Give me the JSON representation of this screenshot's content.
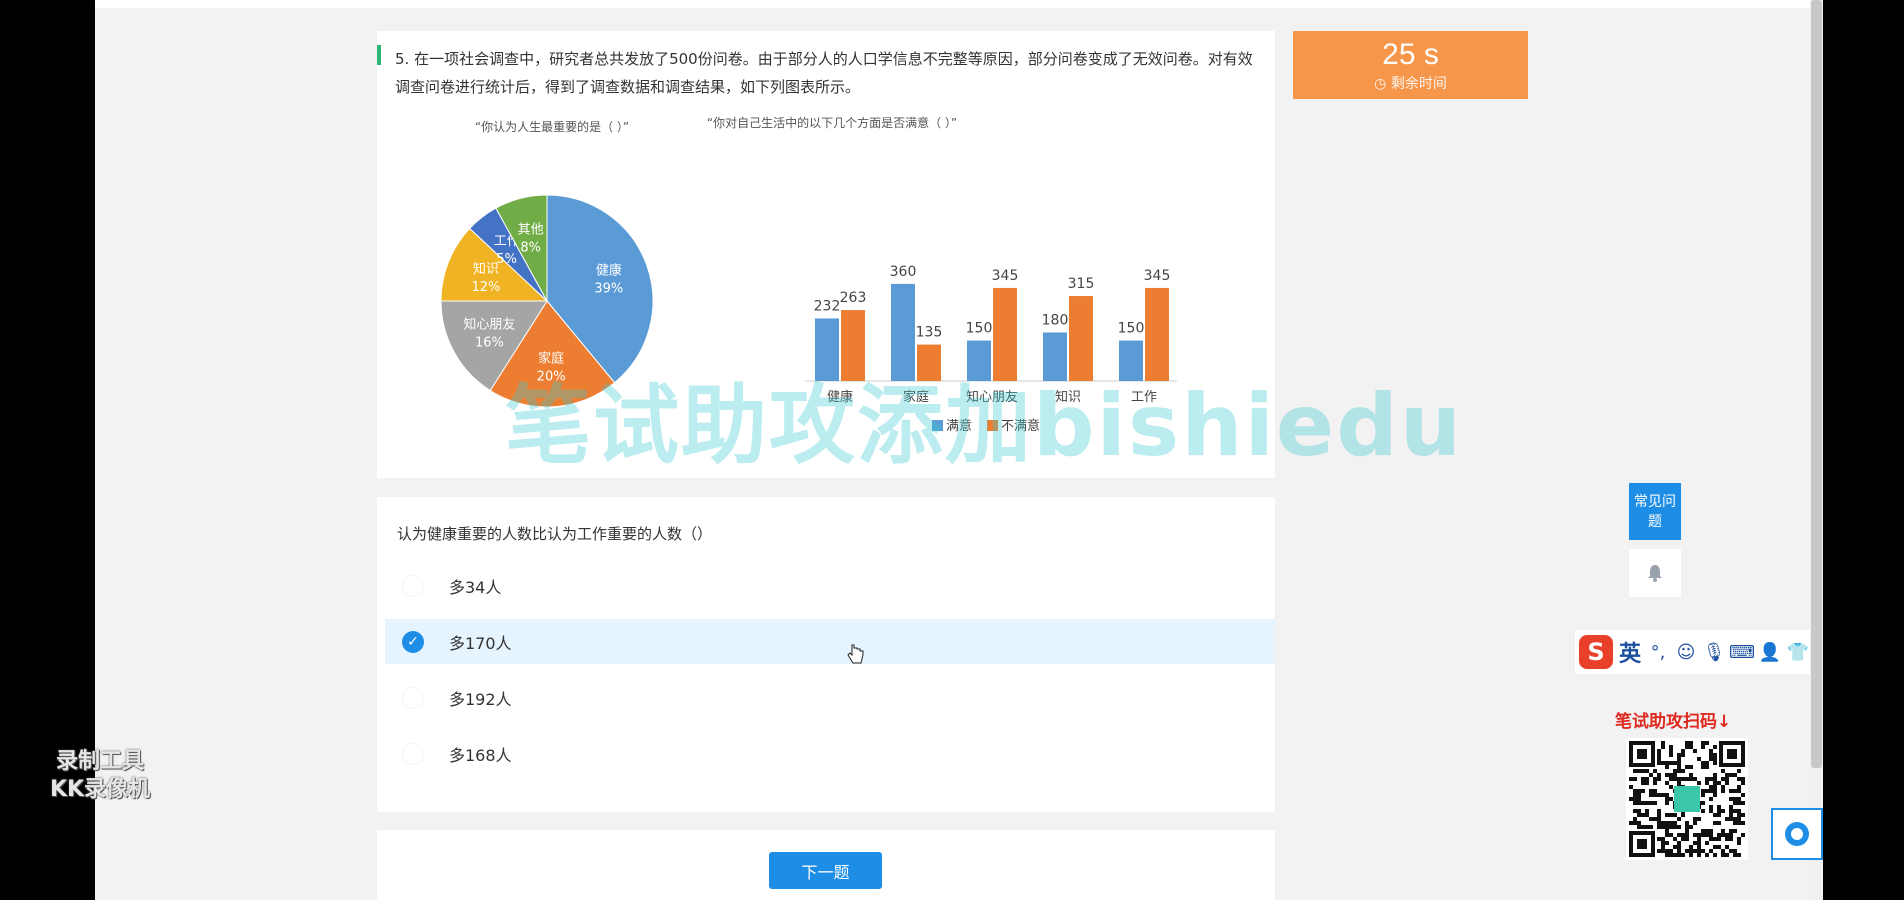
{
  "question": {
    "number": "5.",
    "text": "在一项社会调查中，研究者总共发放了500份问卷。由于部分人的人口学信息不完整等原因，部分问卷变成了无效问卷。对有效调查问卷进行统计后，得到了调查数据和调查结果，如下列图表所示。"
  },
  "timer": {
    "value": "25 s",
    "label": "剩余时间"
  },
  "chart_data": [
    {
      "type": "pie",
      "title": "“你认为人生最重要的是（ ）”",
      "slices": [
        {
          "label": "健康",
          "value": 39,
          "value_label": "39%",
          "color": "#5b9bd5"
        },
        {
          "label": "家庭",
          "value": 20,
          "value_label": "20%",
          "color": "#ed7d31"
        },
        {
          "label": "知心朋友",
          "value": 16,
          "value_label": "16%",
          "color": "#a5a5a5"
        },
        {
          "label": "知识",
          "value": 12,
          "value_label": "12%",
          "color": "#f0b323"
        },
        {
          "label": "工作",
          "value": 5,
          "value_label": "5%",
          "color": "#4472c4"
        },
        {
          "label": "其他",
          "value": 8,
          "value_label": "8%",
          "color": "#70ad47"
        }
      ]
    },
    {
      "type": "bar",
      "title": "“你对自己生活中的以下几个方面是否满意（ ）”",
      "categories": [
        "健康",
        "家庭",
        "知心朋友",
        "知识",
        "工作"
      ],
      "series": [
        {
          "name": "满意",
          "values": [
            232,
            360,
            150,
            180,
            150
          ],
          "color": "#5b9bd5"
        },
        {
          "name": "不满意",
          "values": [
            263,
            135,
            345,
            315,
            345
          ],
          "color": "#ed7d31"
        }
      ],
      "ylim": [
        0,
        400
      ],
      "legend": "bottom"
    }
  ],
  "options": {
    "prompt": "认为健康重要的人数比认为工作重要的人数（）",
    "items": [
      {
        "text": "多34人",
        "selected": false
      },
      {
        "text": "多170人",
        "selected": true
      },
      {
        "text": "多192人",
        "selected": false
      },
      {
        "text": "多168人",
        "selected": false
      }
    ]
  },
  "next_button": "下一题",
  "faq_button": "常见问题",
  "ime": {
    "mode": "英"
  },
  "qr_title": "笔试助攻扫码↓",
  "kk_logo": {
    "line1": "录制工具",
    "line2": "KK录像机"
  },
  "watermark": "笔试助攻添加bishiedu"
}
